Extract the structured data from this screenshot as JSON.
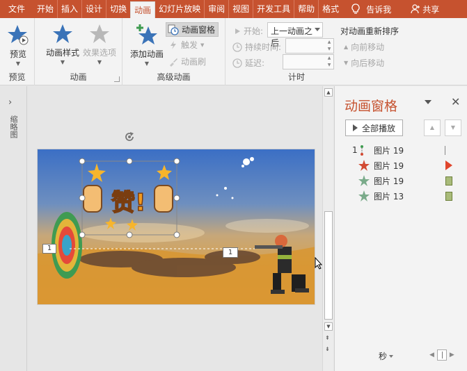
{
  "tabs": [
    {
      "label": "文件",
      "active": false
    },
    {
      "label": "开始",
      "active": false
    },
    {
      "label": "插入",
      "active": false
    },
    {
      "label": "设计",
      "active": false
    },
    {
      "label": "切换",
      "active": false
    },
    {
      "label": "动画",
      "active": true
    },
    {
      "label": "幻灯片放映",
      "active": false
    },
    {
      "label": "审阅",
      "active": false
    },
    {
      "label": "视图",
      "active": false
    },
    {
      "label": "开发工具",
      "active": false
    },
    {
      "label": "帮助",
      "active": false
    },
    {
      "label": "格式",
      "active": false
    }
  ],
  "tell_me": "告诉我",
  "share": "共享",
  "ribbon": {
    "preview": {
      "button": "预览",
      "group": "预览"
    },
    "animation": {
      "style": "动画样式",
      "effect_options": "效果选项",
      "group": "动画"
    },
    "advanced": {
      "add": "添加动画",
      "pane": "动画窗格",
      "trigger": "触发",
      "painter": "动画刷",
      "group": "高级动画"
    },
    "timing": {
      "start_label": "开始:",
      "start_value": "上一动画之后",
      "duration_label": "持续时间:",
      "delay_label": "延迟:",
      "group": "计时"
    },
    "reorder": {
      "title": "对动画重新排序",
      "earlier": "向前移动",
      "later": "向后移动"
    }
  },
  "rail": {
    "label": "缩略图"
  },
  "slide": {
    "tag_left": "1",
    "tag_right": "1",
    "like_text": "赞!"
  },
  "pane": {
    "title": "动画窗格",
    "play_all": "全部播放",
    "items": [
      {
        "num": "1",
        "icon": "path-icon",
        "name": "图片 19",
        "timing": "line"
      },
      {
        "num": "",
        "icon": "star-red-icon",
        "name": "图片 19",
        "timing": "triangle"
      },
      {
        "num": "",
        "icon": "star-green-icon",
        "name": "图片 19",
        "timing": "bar"
      },
      {
        "num": "",
        "icon": "star-green-icon",
        "name": "图片 13",
        "timing": "bar"
      }
    ],
    "footer_unit": "秒"
  },
  "colors": {
    "accent": "#c6522f",
    "star_blue": "#3a73b8",
    "emphasis_red": "#d24a33",
    "exit_green": "#7aab8a"
  }
}
